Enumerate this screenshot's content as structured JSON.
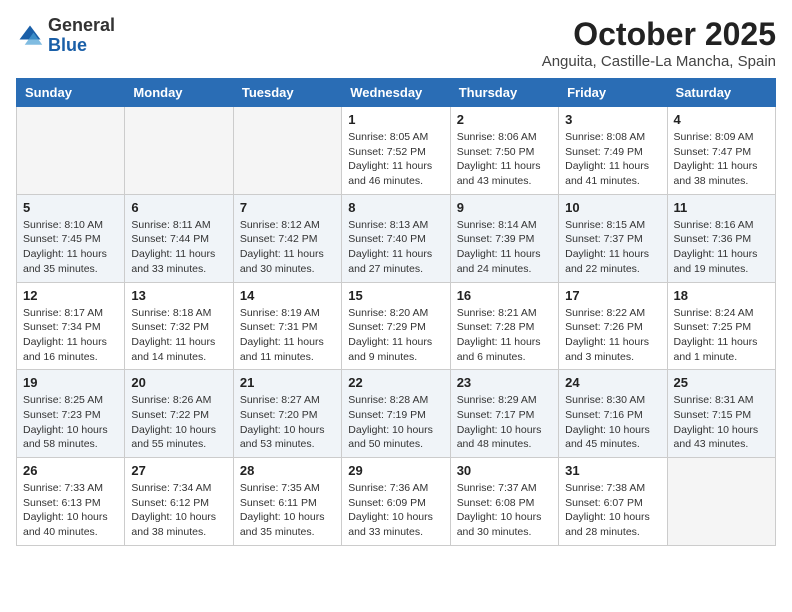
{
  "header": {
    "logo_general": "General",
    "logo_blue": "Blue",
    "month_year": "October 2025",
    "location": "Anguita, Castille-La Mancha, Spain"
  },
  "weekdays": [
    "Sunday",
    "Monday",
    "Tuesday",
    "Wednesday",
    "Thursday",
    "Friday",
    "Saturday"
  ],
  "weeks": [
    [
      {
        "day": "",
        "info": ""
      },
      {
        "day": "",
        "info": ""
      },
      {
        "day": "",
        "info": ""
      },
      {
        "day": "1",
        "info": "Sunrise: 8:05 AM\nSunset: 7:52 PM\nDaylight: 11 hours\nand 46 minutes."
      },
      {
        "day": "2",
        "info": "Sunrise: 8:06 AM\nSunset: 7:50 PM\nDaylight: 11 hours\nand 43 minutes."
      },
      {
        "day": "3",
        "info": "Sunrise: 8:08 AM\nSunset: 7:49 PM\nDaylight: 11 hours\nand 41 minutes."
      },
      {
        "day": "4",
        "info": "Sunrise: 8:09 AM\nSunset: 7:47 PM\nDaylight: 11 hours\nand 38 minutes."
      }
    ],
    [
      {
        "day": "5",
        "info": "Sunrise: 8:10 AM\nSunset: 7:45 PM\nDaylight: 11 hours\nand 35 minutes."
      },
      {
        "day": "6",
        "info": "Sunrise: 8:11 AM\nSunset: 7:44 PM\nDaylight: 11 hours\nand 33 minutes."
      },
      {
        "day": "7",
        "info": "Sunrise: 8:12 AM\nSunset: 7:42 PM\nDaylight: 11 hours\nand 30 minutes."
      },
      {
        "day": "8",
        "info": "Sunrise: 8:13 AM\nSunset: 7:40 PM\nDaylight: 11 hours\nand 27 minutes."
      },
      {
        "day": "9",
        "info": "Sunrise: 8:14 AM\nSunset: 7:39 PM\nDaylight: 11 hours\nand 24 minutes."
      },
      {
        "day": "10",
        "info": "Sunrise: 8:15 AM\nSunset: 7:37 PM\nDaylight: 11 hours\nand 22 minutes."
      },
      {
        "day": "11",
        "info": "Sunrise: 8:16 AM\nSunset: 7:36 PM\nDaylight: 11 hours\nand 19 minutes."
      }
    ],
    [
      {
        "day": "12",
        "info": "Sunrise: 8:17 AM\nSunset: 7:34 PM\nDaylight: 11 hours\nand 16 minutes."
      },
      {
        "day": "13",
        "info": "Sunrise: 8:18 AM\nSunset: 7:32 PM\nDaylight: 11 hours\nand 14 minutes."
      },
      {
        "day": "14",
        "info": "Sunrise: 8:19 AM\nSunset: 7:31 PM\nDaylight: 11 hours\nand 11 minutes."
      },
      {
        "day": "15",
        "info": "Sunrise: 8:20 AM\nSunset: 7:29 PM\nDaylight: 11 hours\nand 9 minutes."
      },
      {
        "day": "16",
        "info": "Sunrise: 8:21 AM\nSunset: 7:28 PM\nDaylight: 11 hours\nand 6 minutes."
      },
      {
        "day": "17",
        "info": "Sunrise: 8:22 AM\nSunset: 7:26 PM\nDaylight: 11 hours\nand 3 minutes."
      },
      {
        "day": "18",
        "info": "Sunrise: 8:24 AM\nSunset: 7:25 PM\nDaylight: 11 hours\nand 1 minute."
      }
    ],
    [
      {
        "day": "19",
        "info": "Sunrise: 8:25 AM\nSunset: 7:23 PM\nDaylight: 10 hours\nand 58 minutes."
      },
      {
        "day": "20",
        "info": "Sunrise: 8:26 AM\nSunset: 7:22 PM\nDaylight: 10 hours\nand 55 minutes."
      },
      {
        "day": "21",
        "info": "Sunrise: 8:27 AM\nSunset: 7:20 PM\nDaylight: 10 hours\nand 53 minutes."
      },
      {
        "day": "22",
        "info": "Sunrise: 8:28 AM\nSunset: 7:19 PM\nDaylight: 10 hours\nand 50 minutes."
      },
      {
        "day": "23",
        "info": "Sunrise: 8:29 AM\nSunset: 7:17 PM\nDaylight: 10 hours\nand 48 minutes."
      },
      {
        "day": "24",
        "info": "Sunrise: 8:30 AM\nSunset: 7:16 PM\nDaylight: 10 hours\nand 45 minutes."
      },
      {
        "day": "25",
        "info": "Sunrise: 8:31 AM\nSunset: 7:15 PM\nDaylight: 10 hours\nand 43 minutes."
      }
    ],
    [
      {
        "day": "26",
        "info": "Sunrise: 7:33 AM\nSunset: 6:13 PM\nDaylight: 10 hours\nand 40 minutes."
      },
      {
        "day": "27",
        "info": "Sunrise: 7:34 AM\nSunset: 6:12 PM\nDaylight: 10 hours\nand 38 minutes."
      },
      {
        "day": "28",
        "info": "Sunrise: 7:35 AM\nSunset: 6:11 PM\nDaylight: 10 hours\nand 35 minutes."
      },
      {
        "day": "29",
        "info": "Sunrise: 7:36 AM\nSunset: 6:09 PM\nDaylight: 10 hours\nand 33 minutes."
      },
      {
        "day": "30",
        "info": "Sunrise: 7:37 AM\nSunset: 6:08 PM\nDaylight: 10 hours\nand 30 minutes."
      },
      {
        "day": "31",
        "info": "Sunrise: 7:38 AM\nSunset: 6:07 PM\nDaylight: 10 hours\nand 28 minutes."
      },
      {
        "day": "",
        "info": ""
      }
    ]
  ]
}
